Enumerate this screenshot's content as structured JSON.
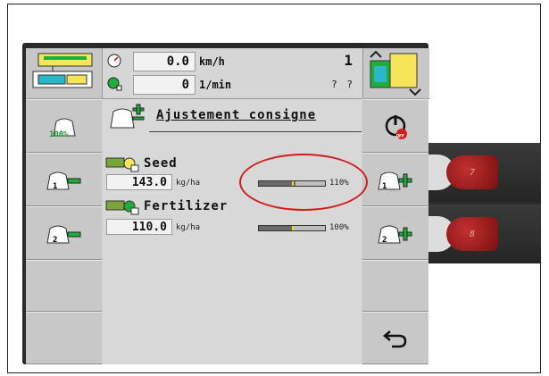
{
  "header": {
    "speed": {
      "value": "0.0",
      "unit": "km/h"
    },
    "rpm": {
      "value": "0",
      "unit": "1/min"
    },
    "section_count": "1",
    "section_unknown": "? ?"
  },
  "page": {
    "title": "Ajustement consigne"
  },
  "left_column": {
    "items": [
      {
        "badge": "100%"
      },
      {
        "badge": "1"
      },
      {
        "badge": "2"
      },
      {
        "badge": ""
      },
      {
        "badge": ""
      }
    ]
  },
  "right_column": {
    "items": [
      {
        "badge": "OFF"
      },
      {
        "badge": "1"
      },
      {
        "badge": "2"
      },
      {
        "badge": ""
      },
      {
        "badge": ""
      }
    ]
  },
  "products": [
    {
      "name": "Seed",
      "rate": "143.0",
      "unit": "kg/ha",
      "percent_label": "110%",
      "percent": 110
    },
    {
      "name": "Fertilizer",
      "rate": "110.0",
      "unit": "kg/ha",
      "percent_label": "100%",
      "percent": 100
    }
  ],
  "hardware_keys": [
    {
      "label": "7"
    },
    {
      "label": "8"
    }
  ],
  "colors": {
    "accent_green": "#1fae3a",
    "accent_yellow": "#e5e000",
    "highlight_red": "#d21d1d"
  }
}
